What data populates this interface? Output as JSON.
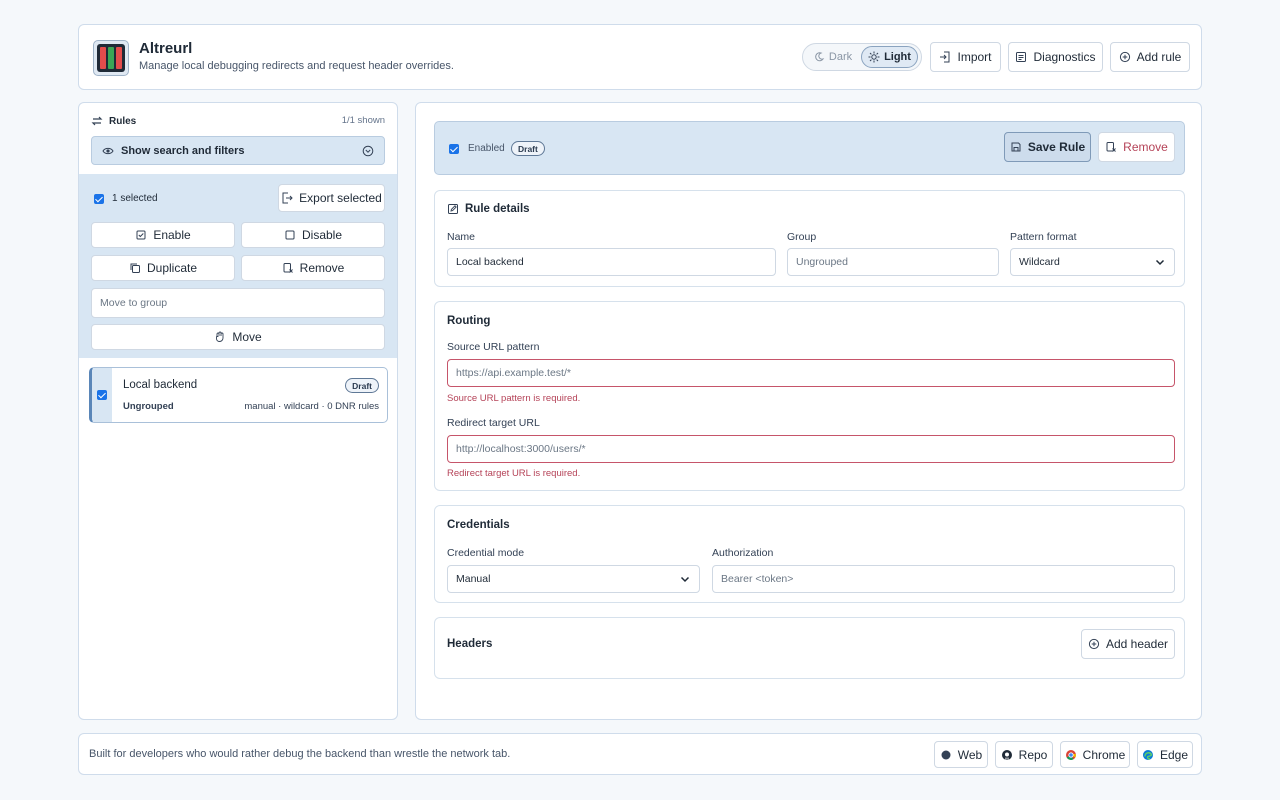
{
  "header": {
    "app_title": "Altreurl",
    "subtitle": "Manage local debugging redirects and request header overrides.",
    "theme": {
      "dark_label": "Dark",
      "light_label": "Light",
      "active": "Light"
    },
    "import_label": "Import",
    "diagnostics_label": "Diagnostics",
    "add_rule_label": "Add rule"
  },
  "sidebar": {
    "title": "Rules",
    "shown_count": "1/1 shown",
    "search_toggle_label": "Show search and filters",
    "selected_count": "1 selected",
    "export_selected_label": "Export selected",
    "enable_label": "Enable",
    "disable_label": "Disable",
    "duplicate_label": "Duplicate",
    "remove_label": "Remove",
    "move_to_group_placeholder": "Move to group",
    "move_label": "Move",
    "rules": [
      {
        "name": "Local backend",
        "badge": "Draft",
        "group": "Ungrouped",
        "meta": "manual · wildcard · 0 DNR rules"
      }
    ]
  },
  "editor": {
    "enabled_label": "Enabled",
    "status_badge": "Draft",
    "save_label": "Save Rule",
    "remove_label": "Remove",
    "rule_details": {
      "title": "Rule details",
      "name_label": "Name",
      "name_value": "Local backend",
      "group_label": "Group",
      "group_placeholder": "Ungrouped",
      "pattern_format_label": "Pattern format",
      "pattern_format_value": "Wildcard"
    },
    "routing": {
      "title": "Routing",
      "source_label": "Source URL pattern",
      "source_placeholder": "https://api.example.test/*",
      "source_error": "Source URL pattern is required.",
      "target_label": "Redirect target URL",
      "target_placeholder": "http://localhost:3000/users/*",
      "target_error": "Redirect target URL is required."
    },
    "credentials": {
      "title": "Credentials",
      "mode_label": "Credential mode",
      "mode_value": "Manual",
      "auth_label": "Authorization",
      "auth_placeholder": "Bearer <token>"
    },
    "headers": {
      "title": "Headers",
      "add_header_label": "Add header"
    }
  },
  "footer": {
    "tagline": "Built for developers who would rather debug the backend than wrestle the network tab.",
    "links": [
      "Web",
      "Repo",
      "Chrome",
      "Edge"
    ]
  },
  "colors": {
    "accent": "#1a73e8",
    "panel_highlight": "#d8e6f3",
    "error": "#b54358",
    "border": "#cfdceb"
  }
}
